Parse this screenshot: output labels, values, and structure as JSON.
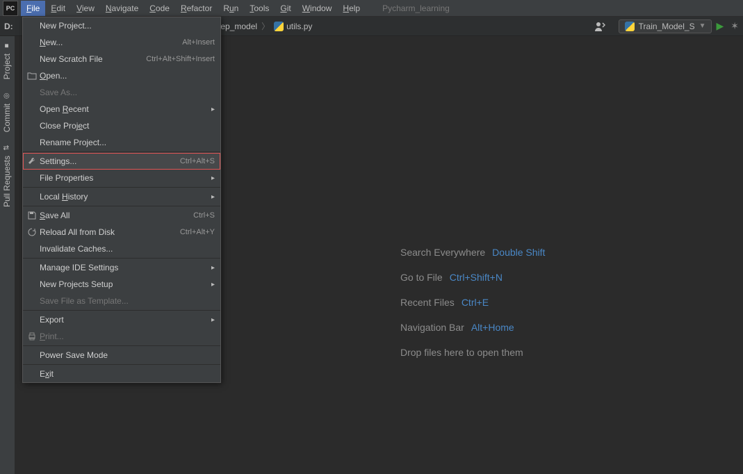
{
  "app": {
    "icon_text": "PC",
    "project_name": "Pycharm_learning"
  },
  "menubar": [
    {
      "label": "File",
      "underline": 0,
      "active": true
    },
    {
      "label": "Edit",
      "underline": 0
    },
    {
      "label": "View",
      "underline": 0
    },
    {
      "label": "Navigate",
      "underline": 0
    },
    {
      "label": "Code",
      "underline": 0
    },
    {
      "label": "Refactor",
      "underline": 0
    },
    {
      "label": "Run",
      "underline": 1
    },
    {
      "label": "Tools",
      "underline": 0
    },
    {
      "label": "Git",
      "underline": 0
    },
    {
      "label": "Window",
      "underline": 0
    },
    {
      "label": "Help",
      "underline": 0
    }
  ],
  "navbar": {
    "drive": "D:",
    "crumbs": [
      {
        "label": "eep_model",
        "icon": null,
        "sep": "〉"
      },
      {
        "label": "utils.py",
        "icon": "py"
      }
    ]
  },
  "run": {
    "config_name": "Train_Model_S"
  },
  "left_tabs": [
    {
      "label": "Project",
      "icon": "folder-icon"
    },
    {
      "label": "Commit",
      "icon": "commit-icon"
    },
    {
      "label": "Pull Requests",
      "icon": "pr-icon"
    }
  ],
  "hints": [
    {
      "label": "Search Everywhere",
      "shortcut": "Double Shift"
    },
    {
      "label": "Go to File",
      "shortcut": "Ctrl+Shift+N"
    },
    {
      "label": "Recent Files",
      "shortcut": "Ctrl+E"
    },
    {
      "label": "Navigation Bar",
      "shortcut": "Alt+Home"
    },
    {
      "label": "Drop files here to open them",
      "shortcut": ""
    }
  ],
  "file_menu": {
    "groups": [
      [
        {
          "label": "New Project...",
          "icon": null
        },
        {
          "label": "New...",
          "underline": 0,
          "shortcut": "Alt+Insert"
        },
        {
          "label": "New Scratch File",
          "shortcut": "Ctrl+Alt+Shift+Insert"
        },
        {
          "label": "Open...",
          "icon": "open",
          "underline": 0
        },
        {
          "label": "Save As...",
          "disabled": true
        },
        {
          "label": "Open Recent",
          "submenu": true,
          "underline": 5
        },
        {
          "label": "Close Project",
          "underline": 10
        },
        {
          "label": "Rename Project..."
        }
      ],
      [
        {
          "label": "Settings...",
          "icon": "wrench",
          "shortcut": "Ctrl+Alt+S",
          "highlighted": true
        },
        {
          "label": "File Properties",
          "submenu": true
        }
      ],
      [
        {
          "label": "Local History",
          "submenu": true,
          "underline": 6
        }
      ],
      [
        {
          "label": "Save All",
          "icon": "save",
          "shortcut": "Ctrl+S",
          "underline": 0
        },
        {
          "label": "Reload All from Disk",
          "icon": "reload",
          "shortcut": "Ctrl+Alt+Y"
        },
        {
          "label": "Invalidate Caches..."
        }
      ],
      [
        {
          "label": "Manage IDE Settings",
          "submenu": true
        },
        {
          "label": "New Projects Setup",
          "submenu": true
        },
        {
          "label": "Save File as Template...",
          "disabled": true
        }
      ],
      [
        {
          "label": "Export",
          "submenu": true
        },
        {
          "label": "Print...",
          "icon": "print",
          "underline": 0,
          "disabled": true
        }
      ],
      [
        {
          "label": "Power Save Mode"
        }
      ],
      [
        {
          "label": "Exit",
          "underline": 1
        }
      ]
    ]
  }
}
